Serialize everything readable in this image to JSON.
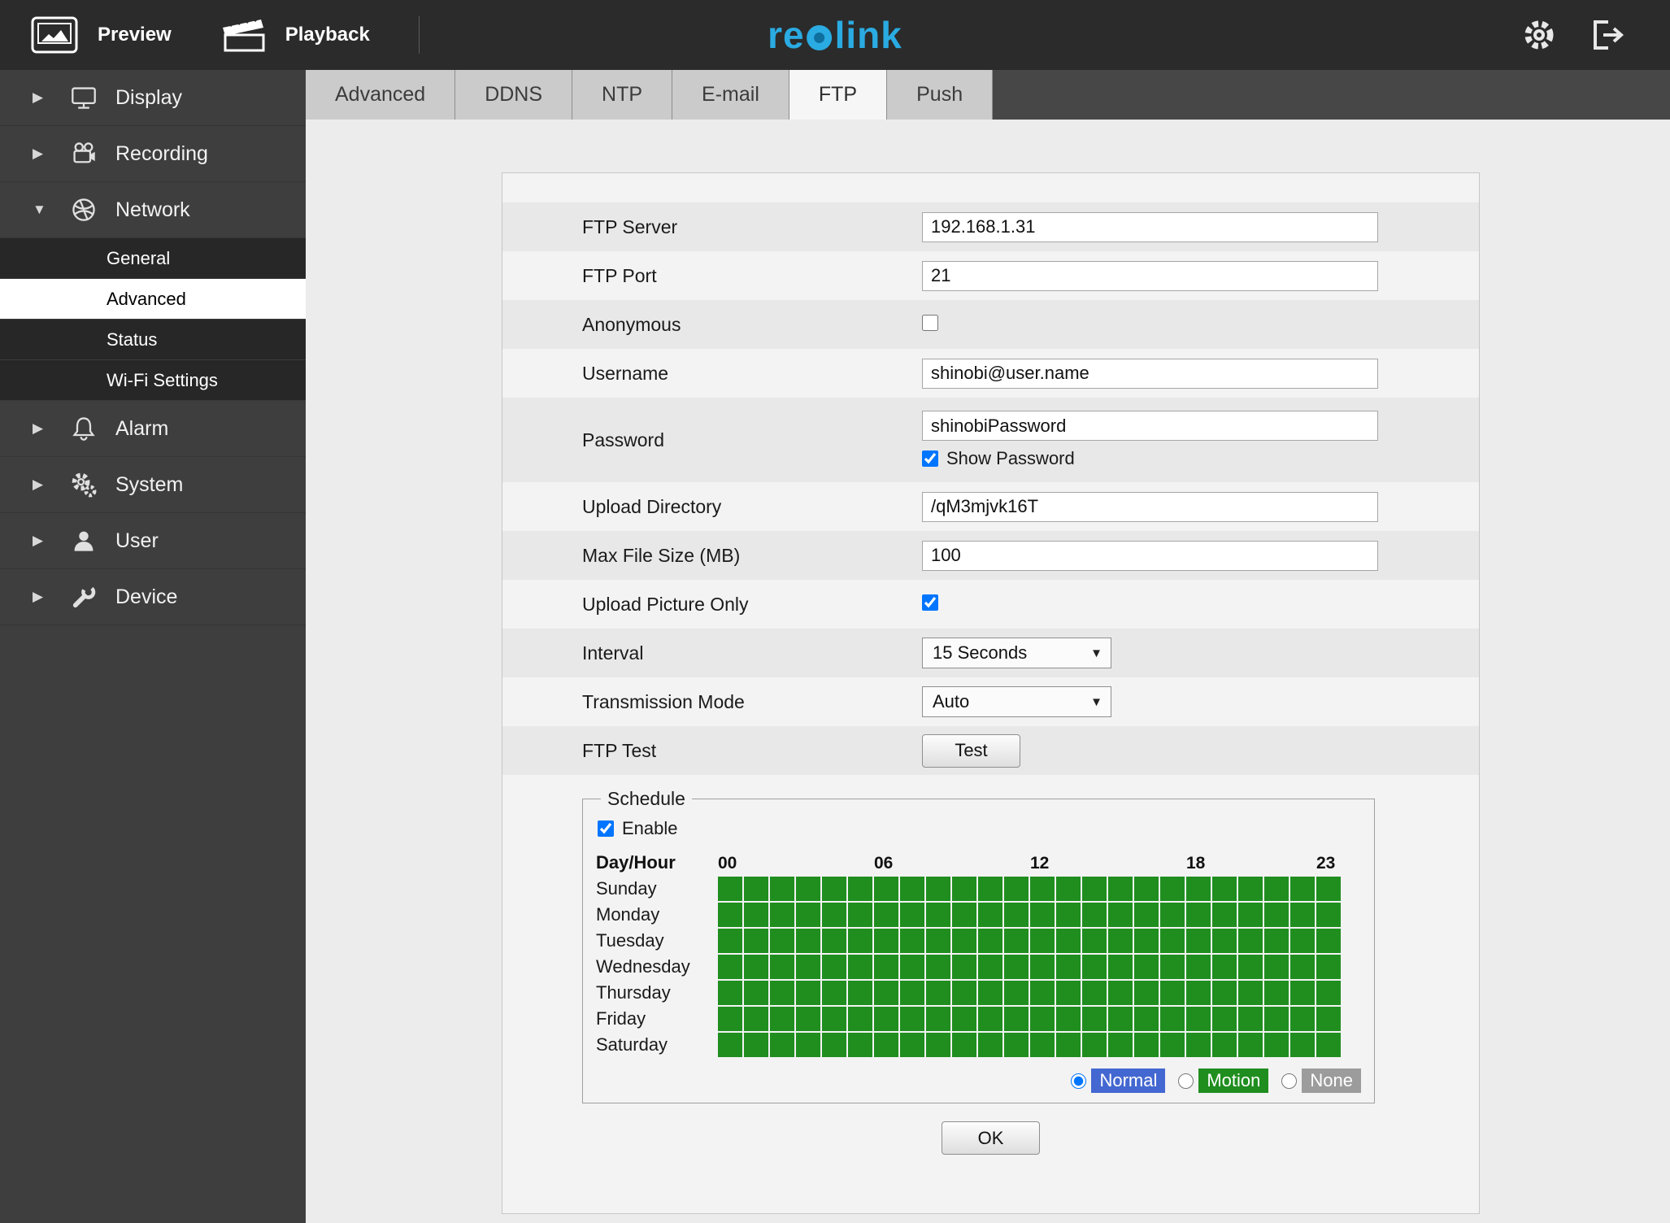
{
  "topbar": {
    "preview_label": "Preview",
    "playback_label": "Playback",
    "logo_left": "re",
    "logo_right": "link",
    "logo_color": "#2aabe2"
  },
  "sidebar": {
    "items": [
      {
        "label": "Display",
        "icon": "display-icon",
        "expanded": false
      },
      {
        "label": "Recording",
        "icon": "recording-icon",
        "expanded": false
      },
      {
        "label": "Network",
        "icon": "network-icon",
        "expanded": true
      },
      {
        "label": "Alarm",
        "icon": "alarm-icon",
        "expanded": false
      },
      {
        "label": "System",
        "icon": "system-icon",
        "expanded": false
      },
      {
        "label": "User",
        "icon": "user-icon",
        "expanded": false
      },
      {
        "label": "Device",
        "icon": "device-icon",
        "expanded": false
      }
    ],
    "network_submenu": [
      {
        "label": "General",
        "selected": false
      },
      {
        "label": "Advanced",
        "selected": true
      },
      {
        "label": "Status",
        "selected": false
      },
      {
        "label": "Wi-Fi Settings",
        "selected": false
      }
    ]
  },
  "tabs": [
    {
      "label": "Advanced",
      "active": false
    },
    {
      "label": "DDNS",
      "active": false
    },
    {
      "label": "NTP",
      "active": false
    },
    {
      "label": "E-mail",
      "active": false
    },
    {
      "label": "FTP",
      "active": true
    },
    {
      "label": "Push",
      "active": false
    }
  ],
  "form": {
    "ftp_server": {
      "label": "FTP Server",
      "value": "192.168.1.31"
    },
    "ftp_port": {
      "label": "FTP Port",
      "value": "21"
    },
    "anonymous": {
      "label": "Anonymous",
      "checked": false
    },
    "username": {
      "label": "Username",
      "value": "shinobi@user.name"
    },
    "password": {
      "label": "Password",
      "value": "shinobiPassword",
      "show_password_label": "Show Password",
      "show_password_checked": true
    },
    "upload_directory": {
      "label": "Upload Directory",
      "value": "/qM3mjvk16T"
    },
    "max_file_size": {
      "label": "Max File Size (MB)",
      "value": "100"
    },
    "upload_picture_only": {
      "label": "Upload Picture Only",
      "checked": true
    },
    "interval": {
      "label": "Interval",
      "value": "15 Seconds"
    },
    "transmission_mode": {
      "label": "Transmission Mode",
      "value": "Auto"
    },
    "ftp_test": {
      "label": "FTP Test",
      "button_label": "Test"
    }
  },
  "schedule": {
    "legend": "Schedule",
    "enable_label": "Enable",
    "enable_checked": true,
    "day_hour_label": "Day/Hour",
    "hour_labels": [
      {
        "text": "00",
        "col": 0
      },
      {
        "text": "06",
        "col": 6
      },
      {
        "text": "12",
        "col": 12
      },
      {
        "text": "18",
        "col": 18
      },
      {
        "text": "23",
        "col": 23
      }
    ],
    "days": [
      "Sunday",
      "Monday",
      "Tuesday",
      "Wednesday",
      "Thursday",
      "Friday",
      "Saturday"
    ],
    "columns": 24,
    "cell_color": "#1f8e1f",
    "modes": [
      {
        "label": "Normal",
        "color": "#4468d1",
        "selected": true
      },
      {
        "label": "Motion",
        "color": "#1f8e1f",
        "selected": false
      },
      {
        "label": "None",
        "color": "#9c9c9c",
        "selected": false
      }
    ]
  },
  "ok_label": "OK"
}
